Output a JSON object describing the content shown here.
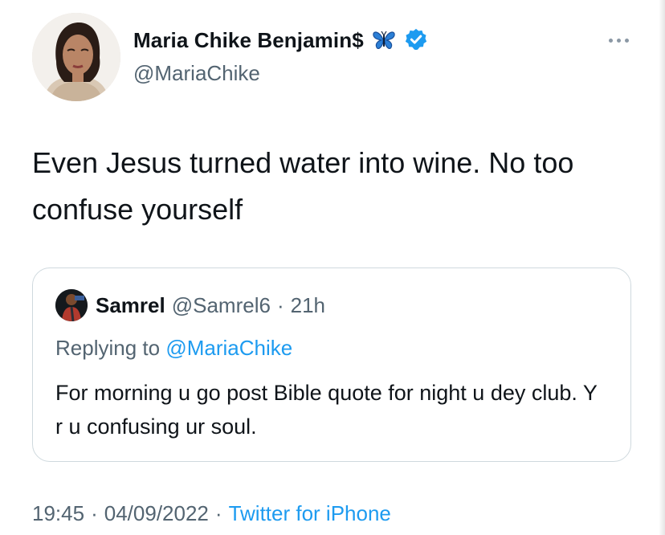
{
  "author": {
    "display_name": "Maria Chike Benjamin$",
    "handle": "@MariaChike",
    "name_emoji": "blue-butterfly-icon",
    "verified": true
  },
  "tweet": {
    "text": "Even Jesus turned water into wine. No too confuse yourself"
  },
  "quoted_tweet": {
    "author_name": "Samrel",
    "author_handle": "@Samrel6",
    "separator": "·",
    "time": "21h",
    "replying_prefix": "Replying to",
    "replying_to": "@MariaChike",
    "text": "For morning u go post Bible quote for night u dey club. Y r u confusing ur soul."
  },
  "footer": {
    "time": "19:45",
    "separator": "·",
    "date": "04/09/2022",
    "separator2": "·",
    "source": "Twitter for iPhone"
  },
  "colors": {
    "accent": "#1d9bf0",
    "text_primary": "#0f1419",
    "text_secondary": "#536471",
    "border": "#cfd9de"
  },
  "icons": [
    "avatar",
    "blue-butterfly-icon",
    "verified-badge-icon",
    "more-options-icon"
  ]
}
